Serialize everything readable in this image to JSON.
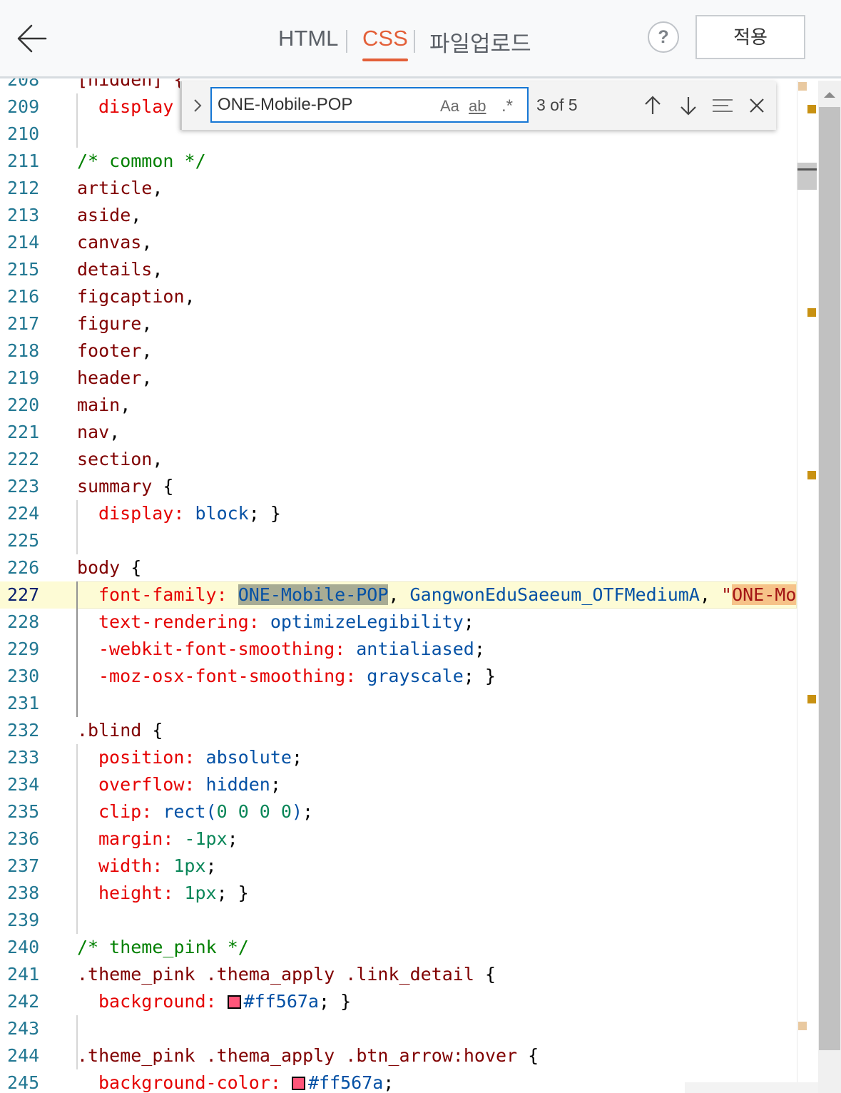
{
  "header": {
    "tabs": [
      {
        "label": "HTML",
        "active": false
      },
      {
        "label": "CSS",
        "active": true
      },
      {
        "label": "파일업로드",
        "active": false
      }
    ],
    "help_label": "?",
    "apply_label": "적용",
    "back_icon": "arrow-left-icon"
  },
  "find": {
    "value": "ONE-Mobile-POP",
    "match_case_label": "Aa",
    "whole_word_label": "ab",
    "regex_label": ".*",
    "result_count": "3 of 5",
    "icons": [
      "chevron-right-icon",
      "arrow-up-icon",
      "arrow-down-icon",
      "find-in-selection-icon",
      "close-icon"
    ]
  },
  "editor": {
    "current_line": 227,
    "lines": [
      {
        "n": "208",
        "indent": 0,
        "tokens": [
          [
            "[hidden] {",
            "t-sel"
          ]
        ]
      },
      {
        "n": "209",
        "indent": 1,
        "tokens": [
          [
            "display",
            "t-prop"
          ]
        ]
      },
      {
        "n": "210",
        "indent": 0,
        "tokens": []
      },
      {
        "n": "211",
        "indent": 0,
        "tokens": [
          [
            "/* common */",
            "t-com"
          ]
        ]
      },
      {
        "n": "212",
        "indent": 0,
        "tokens": [
          [
            "article",
            "t-sel"
          ],
          [
            ",",
            "t-punc"
          ]
        ]
      },
      {
        "n": "213",
        "indent": 0,
        "tokens": [
          [
            "aside",
            "t-sel"
          ],
          [
            ",",
            "t-punc"
          ]
        ]
      },
      {
        "n": "214",
        "indent": 0,
        "tokens": [
          [
            "canvas",
            "t-sel"
          ],
          [
            ",",
            "t-punc"
          ]
        ]
      },
      {
        "n": "215",
        "indent": 0,
        "tokens": [
          [
            "details",
            "t-sel"
          ],
          [
            ",",
            "t-punc"
          ]
        ]
      },
      {
        "n": "216",
        "indent": 0,
        "tokens": [
          [
            "figcaption",
            "t-sel"
          ],
          [
            ",",
            "t-punc"
          ]
        ]
      },
      {
        "n": "217",
        "indent": 0,
        "tokens": [
          [
            "figure",
            "t-sel"
          ],
          [
            ",",
            "t-punc"
          ]
        ]
      },
      {
        "n": "218",
        "indent": 0,
        "tokens": [
          [
            "footer",
            "t-sel"
          ],
          [
            ",",
            "t-punc"
          ]
        ]
      },
      {
        "n": "219",
        "indent": 0,
        "tokens": [
          [
            "header",
            "t-sel"
          ],
          [
            ",",
            "t-punc"
          ]
        ]
      },
      {
        "n": "220",
        "indent": 0,
        "tokens": [
          [
            "main",
            "t-sel"
          ],
          [
            ",",
            "t-punc"
          ]
        ]
      },
      {
        "n": "221",
        "indent": 0,
        "tokens": [
          [
            "nav",
            "t-sel"
          ],
          [
            ",",
            "t-punc"
          ]
        ]
      },
      {
        "n": "222",
        "indent": 0,
        "tokens": [
          [
            "section",
            "t-sel"
          ],
          [
            ",",
            "t-punc"
          ]
        ]
      },
      {
        "n": "223",
        "indent": 0,
        "tokens": [
          [
            "summary",
            "t-sel"
          ],
          [
            " {",
            "t-punc"
          ]
        ]
      },
      {
        "n": "224",
        "indent": 1,
        "tokens": [
          [
            "display",
            "t-prop"
          ],
          [
            ": ",
            "t-prop"
          ],
          [
            "block",
            "t-val"
          ],
          [
            "; }",
            "t-punc"
          ]
        ]
      },
      {
        "n": "225",
        "indent": 0,
        "tokens": []
      },
      {
        "n": "226",
        "indent": 0,
        "tokens": [
          [
            "body",
            "t-sel"
          ],
          [
            " {",
            "t-punc"
          ]
        ]
      },
      {
        "n": "227",
        "indent": 1,
        "tokens": [
          [
            "font-family",
            "t-prop"
          ],
          [
            ": ",
            "t-prop"
          ],
          [
            "ONE-Mobile-POP",
            "t-val hl-find"
          ],
          [
            ", ",
            "t-punc"
          ],
          [
            "GangwonEduSaeeum_OTFMediumA",
            "t-val"
          ],
          [
            ", ",
            "t-punc"
          ],
          [
            "\"",
            "t-str"
          ],
          [
            "ONE-Mobile-POP",
            "t-str hl-other"
          ]
        ]
      },
      {
        "n": "228",
        "indent": 1,
        "tokens": [
          [
            "text-rendering",
            "t-prop"
          ],
          [
            ": ",
            "t-prop"
          ],
          [
            "optimizeLegibility",
            "t-val"
          ],
          [
            ";",
            "t-punc"
          ]
        ]
      },
      {
        "n": "229",
        "indent": 1,
        "tokens": [
          [
            "-webkit-font-smoothing",
            "t-prop"
          ],
          [
            ": ",
            "t-prop"
          ],
          [
            "antialiased",
            "t-val"
          ],
          [
            ";",
            "t-punc"
          ]
        ]
      },
      {
        "n": "230",
        "indent": 1,
        "tokens": [
          [
            "-moz-osx-font-smoothing",
            "t-prop"
          ],
          [
            ": ",
            "t-prop"
          ],
          [
            "grayscale",
            "t-val"
          ],
          [
            "; }",
            "t-punc"
          ]
        ]
      },
      {
        "n": "231",
        "indent": 0,
        "tokens": []
      },
      {
        "n": "232",
        "indent": 0,
        "tokens": [
          [
            ".blind",
            "t-sel"
          ],
          [
            " {",
            "t-punc"
          ]
        ]
      },
      {
        "n": "233",
        "indent": 1,
        "tokens": [
          [
            "position",
            "t-prop"
          ],
          [
            ": ",
            "t-prop"
          ],
          [
            "absolute",
            "t-val"
          ],
          [
            ";",
            "t-punc"
          ]
        ]
      },
      {
        "n": "234",
        "indent": 1,
        "tokens": [
          [
            "overflow",
            "t-prop"
          ],
          [
            ": ",
            "t-prop"
          ],
          [
            "hidden",
            "t-val"
          ],
          [
            ";",
            "t-punc"
          ]
        ]
      },
      {
        "n": "235",
        "indent": 1,
        "tokens": [
          [
            "clip",
            "t-prop"
          ],
          [
            ": ",
            "t-prop"
          ],
          [
            "rect(",
            "t-val"
          ],
          [
            "0 0 0 0",
            "t-num"
          ],
          [
            ")",
            "t-val"
          ],
          [
            ";",
            "t-punc"
          ]
        ]
      },
      {
        "n": "236",
        "indent": 1,
        "tokens": [
          [
            "margin",
            "t-prop"
          ],
          [
            ": ",
            "t-prop"
          ],
          [
            "-1px",
            "t-num"
          ],
          [
            ";",
            "t-punc"
          ]
        ]
      },
      {
        "n": "237",
        "indent": 1,
        "tokens": [
          [
            "width",
            "t-prop"
          ],
          [
            ": ",
            "t-prop"
          ],
          [
            "1px",
            "t-num"
          ],
          [
            ";",
            "t-punc"
          ]
        ]
      },
      {
        "n": "238",
        "indent": 1,
        "tokens": [
          [
            "height",
            "t-prop"
          ],
          [
            ": ",
            "t-prop"
          ],
          [
            "1px",
            "t-num"
          ],
          [
            "; }",
            "t-punc"
          ]
        ]
      },
      {
        "n": "239",
        "indent": 0,
        "tokens": []
      },
      {
        "n": "240",
        "indent": 0,
        "tokens": [
          [
            "/* theme_pink */",
            "t-com"
          ]
        ]
      },
      {
        "n": "241",
        "indent": 0,
        "tokens": [
          [
            ".theme_pink .thema_apply .link_detail",
            "t-sel"
          ],
          [
            " {",
            "t-punc"
          ]
        ]
      },
      {
        "n": "242",
        "indent": 1,
        "tokens": [
          [
            "background",
            "t-prop"
          ],
          [
            ": ",
            "t-prop"
          ],
          [
            "@swatch",
            "#ff567a"
          ],
          [
            "#ff567a",
            "t-val"
          ],
          [
            "; }",
            "t-punc"
          ]
        ]
      },
      {
        "n": "243",
        "indent": 0,
        "tokens": []
      },
      {
        "n": "244",
        "indent": 0,
        "tokens": [
          [
            ".theme_pink .thema_apply .btn_arrow:hover",
            "t-sel"
          ],
          [
            " {",
            "t-punc"
          ]
        ]
      },
      {
        "n": "245",
        "indent": 1,
        "tokens": [
          [
            "background-color",
            "t-prop"
          ],
          [
            ": ",
            "t-prop"
          ],
          [
            "@swatch",
            "#ff567a"
          ],
          [
            "#ff567a",
            "t-val"
          ],
          [
            ";",
            "t-punc"
          ]
        ]
      }
    ]
  },
  "colors": {
    "accent": "#e35f38",
    "find_border": "#1576d4",
    "line_number": "#237893",
    "match_marker": "#c89112",
    "swatch_pink": "#ff567a"
  }
}
